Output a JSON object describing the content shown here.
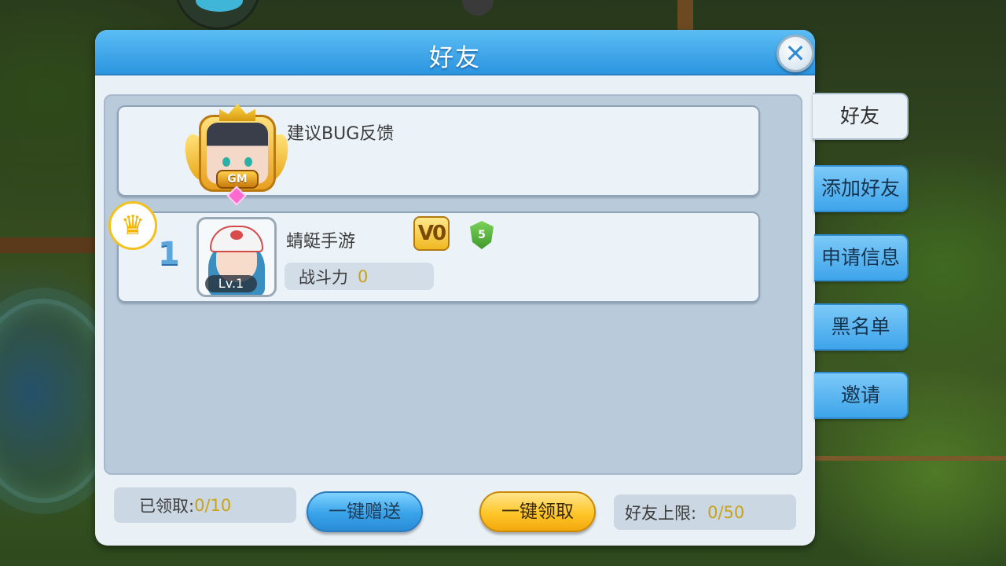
{
  "dialog": {
    "title": "好友",
    "close_icon": "close-icon"
  },
  "side_tabs": [
    {
      "label": "好友",
      "active": true
    },
    {
      "label": "添加好友",
      "active": false
    },
    {
      "label": "申请信息",
      "active": false
    },
    {
      "label": "黑名单",
      "active": false
    },
    {
      "label": "邀请",
      "active": false
    }
  ],
  "gm_entry": {
    "name": "建议BUG反馈",
    "badge": "GM"
  },
  "friends": [
    {
      "rank": "1",
      "name": "蜻蜓手游",
      "level": "Lv.1",
      "vip": "V0",
      "shield_level": "5",
      "power_label": "战斗力",
      "power_value": "0"
    }
  ],
  "footer": {
    "claimed_label": "已领取:",
    "claimed_value": "0/10",
    "send_all_label": "一键赠送",
    "claim_all_label": "一键领取",
    "limit_label": "好友上限:",
    "limit_value": "0/50"
  },
  "colors": {
    "header_blue": "#2b95e0",
    "tab_blue": "#3ea4ea",
    "send_button": "#39a3ea",
    "claim_button": "#ffc62a",
    "value_gold": "#c8a218",
    "panel_bg": "#e9f1f7"
  }
}
